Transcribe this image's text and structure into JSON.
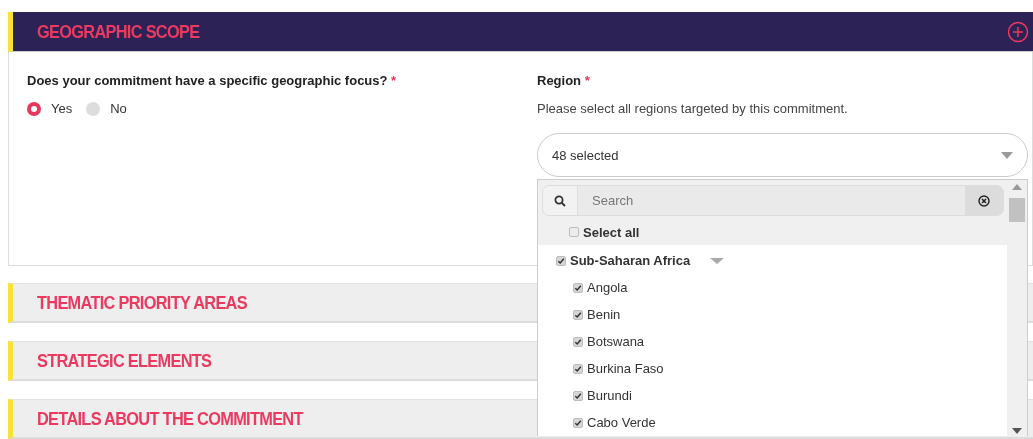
{
  "sections": [
    {
      "title": "GEOGRAPHIC SCOPE",
      "expanded": true
    },
    {
      "title": "THEMATIC PRIORITY AREAS",
      "expanded": false
    },
    {
      "title": "STRATEGIC ELEMENTS",
      "expanded": false
    },
    {
      "title": "DETAILS ABOUT THE COMMITMENT",
      "expanded": false
    }
  ],
  "question": {
    "label": "Does your commitment have a specific geographic focus?",
    "required_mark": "*",
    "options": [
      {
        "label": "Yes",
        "selected": true
      },
      {
        "label": "No",
        "selected": false
      }
    ]
  },
  "region": {
    "label": "Region",
    "required_mark": "*",
    "hint": "Please select all regions targeted by this commitment.",
    "value": "48 selected",
    "search_placeholder": "Search",
    "select_all": {
      "label": "Select all",
      "checked": false
    },
    "groups": [
      {
        "label": "Sub-Saharan Africa",
        "checked": true,
        "expanded": true,
        "children": [
          {
            "label": "Angola",
            "checked": true
          },
          {
            "label": "Benin",
            "checked": true
          },
          {
            "label": "Botswana",
            "checked": true
          },
          {
            "label": "Burkina Faso",
            "checked": true
          },
          {
            "label": "Burundi",
            "checked": true
          },
          {
            "label": "Cabo Verde",
            "checked": true
          }
        ]
      }
    ]
  }
}
